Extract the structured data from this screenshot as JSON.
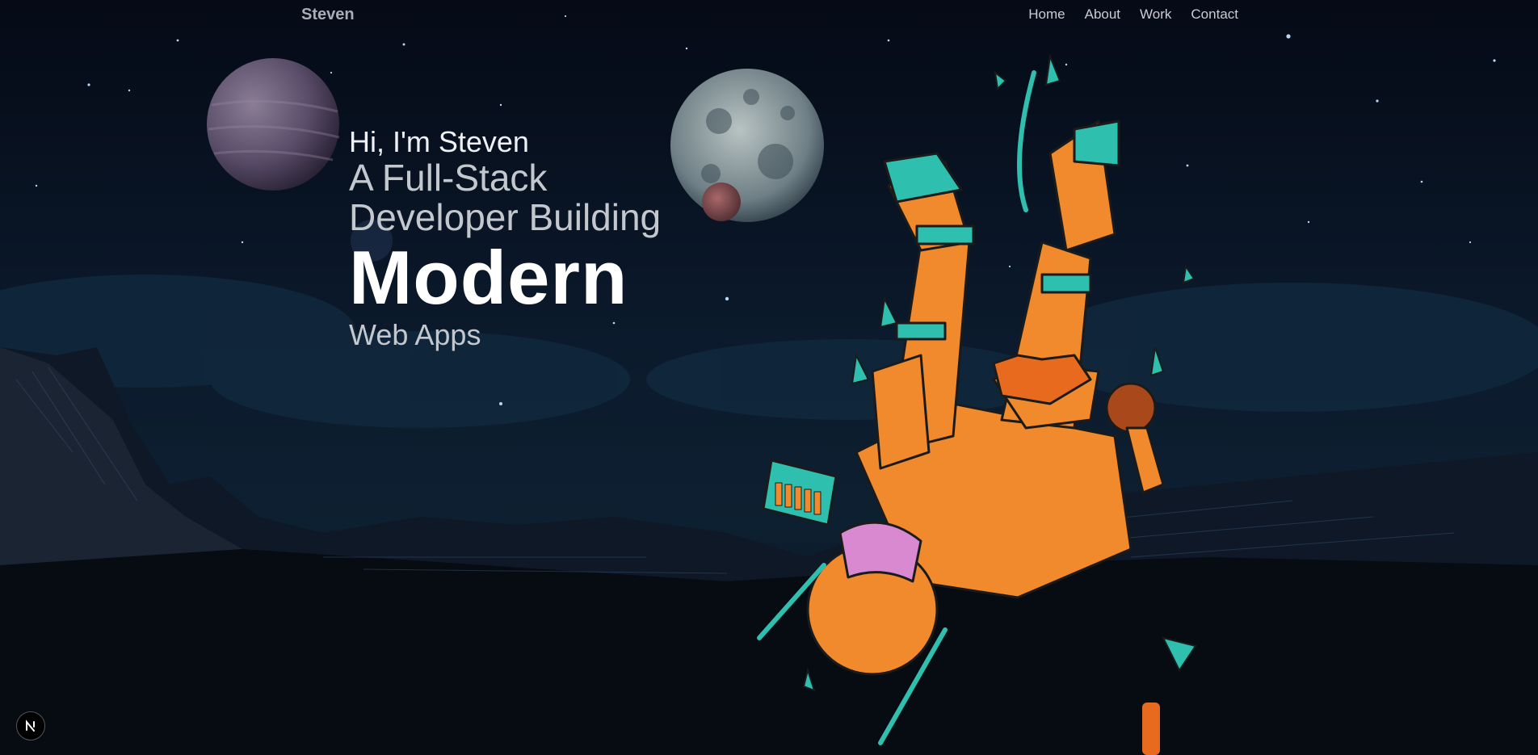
{
  "nav": {
    "brand": "Steven",
    "links": [
      "Home",
      "About",
      "Work",
      "Contact"
    ]
  },
  "hero": {
    "greeting": "Hi, I'm Steven",
    "line1": "A Full-Stack",
    "line2": "Developer Building",
    "highlight": "Modern",
    "line3": "Web Apps"
  },
  "icons": {
    "dev_badge": "nextjs-n-icon",
    "astronaut": "astronaut-illustration"
  },
  "colors": {
    "background": "#060b16",
    "astronaut_orange": "#f08a2c",
    "astronaut_teal": "#2fbfae"
  }
}
